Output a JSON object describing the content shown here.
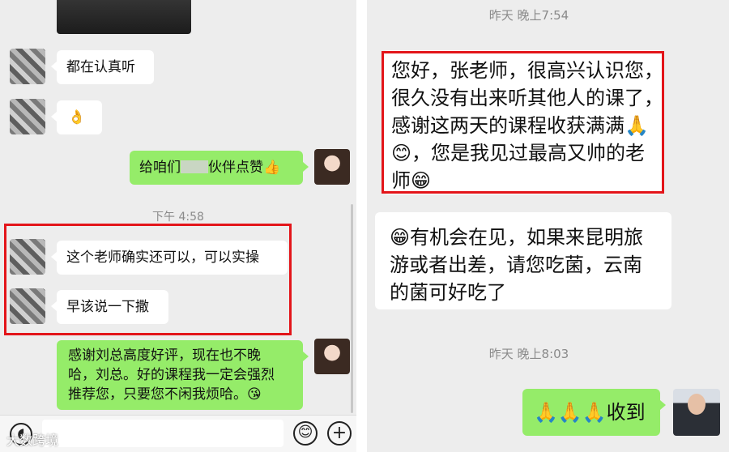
{
  "left_chat": {
    "messages": [
      {
        "text": "都在认真听"
      },
      {
        "text": "👌"
      },
      {
        "text_before": "给咱们",
        "text_after": "伙伴点赞👍"
      },
      {
        "text": "这个老师确实还可以，可以实操"
      },
      {
        "text": "早该说一下撒"
      },
      {
        "lines": [
          "感谢刘总高度好评，现在也不晚",
          "哈，刘总。好的课程我一定会强烈",
          "推荐您，只要您不闲我烦哈。😘"
        ]
      }
    ],
    "timestamp": "下午 4:58",
    "input_bar": {
      "emoji_icon": "😊",
      "add_icon": "+"
    }
  },
  "right_chat": {
    "timestamp_1": "昨天 晚上7:54",
    "message_1_lines": [
      "您好，张老师，很高兴认识您，",
      "很久没有出来听其他人的课了，",
      "感谢这两天的课程收获满满🙏",
      "😊，您是我见过最高又帅的老",
      "师😁"
    ],
    "message_2_lines": [
      "😁有机会在见，如果来昆明旅",
      "游或者出差，请您吃菌，云南",
      "的菌可好吃了"
    ],
    "timestamp_2": "昨天 晚上8:03",
    "message_3": "🙏🙏🙏收到"
  },
  "watermark": "大数跨境",
  "colors": {
    "highlight": "#e3151a",
    "sent_bubble": "#95ec69",
    "received_bubble": "#ffffff",
    "background": "#ededed"
  }
}
